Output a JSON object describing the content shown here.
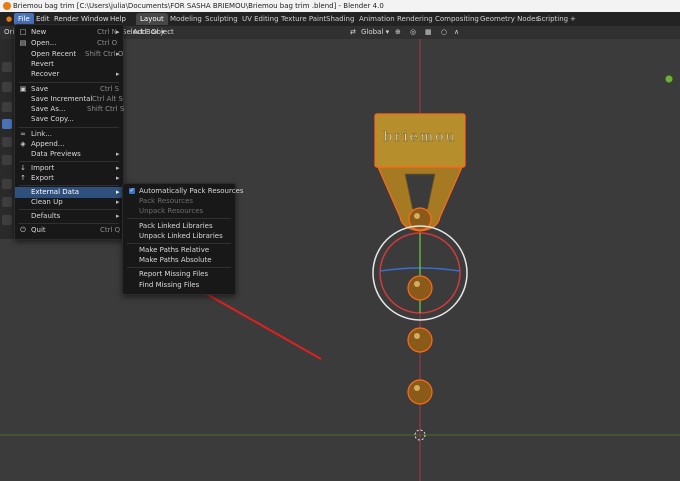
{
  "window_title": "Briemou bag trim  [C:\\Users\\julia\\Documents\\FOR SASHA BRIEMOU\\Briemou bag trim .blend] - Blender 4.0",
  "menubar": [
    "File",
    "Edit",
    "Render",
    "Window",
    "Help"
  ],
  "workspaces": [
    "Layout",
    "Modeling",
    "Sculpting",
    "UV Editing",
    "Texture Paint",
    "Shading",
    "Animation",
    "Rendering",
    "Compositing",
    "Geometry Nodes",
    "Scripting"
  ],
  "add_workspace_icon": "plus-icon",
  "header": {
    "add": "Add",
    "object": "Object",
    "select_box": "Select Box",
    "orientation": "Global",
    "orient_short": "Orie"
  },
  "file_menu": [
    {
      "label": "New",
      "shortcut": "Ctrl N",
      "icon": "new-file-icon",
      "submenu": true
    },
    {
      "label": "Open...",
      "shortcut": "Ctrl O",
      "icon": "folder-icon"
    },
    {
      "label": "Open Recent",
      "shortcut": "Shift Ctrl O",
      "submenu": true
    },
    {
      "label": "Revert"
    },
    {
      "label": "Recover",
      "submenu": true
    },
    {
      "label": "Save",
      "shortcut": "Ctrl S",
      "icon": "save-icon"
    },
    {
      "label": "Save Incremental",
      "shortcut": "Ctrl Alt S"
    },
    {
      "label": "Save As...",
      "shortcut": "Shift Ctrl S"
    },
    {
      "label": "Save Copy..."
    },
    {
      "label": "Link...",
      "icon": "link-icon"
    },
    {
      "label": "Append...",
      "icon": "append-icon"
    },
    {
      "label": "Data Previews",
      "submenu": true
    },
    {
      "label": "Import",
      "icon": "import-icon",
      "submenu": true
    },
    {
      "label": "Export",
      "icon": "export-icon",
      "submenu": true
    },
    {
      "label": "External Data",
      "submenu": true,
      "highlighted": true
    },
    {
      "label": "Clean Up",
      "submenu": true
    },
    {
      "label": "Defaults",
      "submenu": true
    },
    {
      "label": "Quit",
      "shortcut": "Ctrl Q",
      "icon": "power-icon"
    }
  ],
  "external_data_menu": [
    {
      "label": "Automatically Pack Resources",
      "checked": true
    },
    {
      "label": "Pack Resources",
      "disabled": true
    },
    {
      "label": "Unpack Resources",
      "disabled": true
    },
    {
      "label": "Pack Linked Libraries"
    },
    {
      "label": "Unpack Linked Libraries"
    },
    {
      "label": "Make Paths Relative"
    },
    {
      "label": "Make Paths Absolute"
    },
    {
      "label": "Report Missing Files"
    },
    {
      "label": "Find Missing Files"
    }
  ],
  "object_text": "briemou",
  "colors": {
    "accent": "#4a72b8",
    "selection_outline": "#ff6a1a",
    "annotation_arrow": "#e02020",
    "gold": "#b88f2a"
  }
}
